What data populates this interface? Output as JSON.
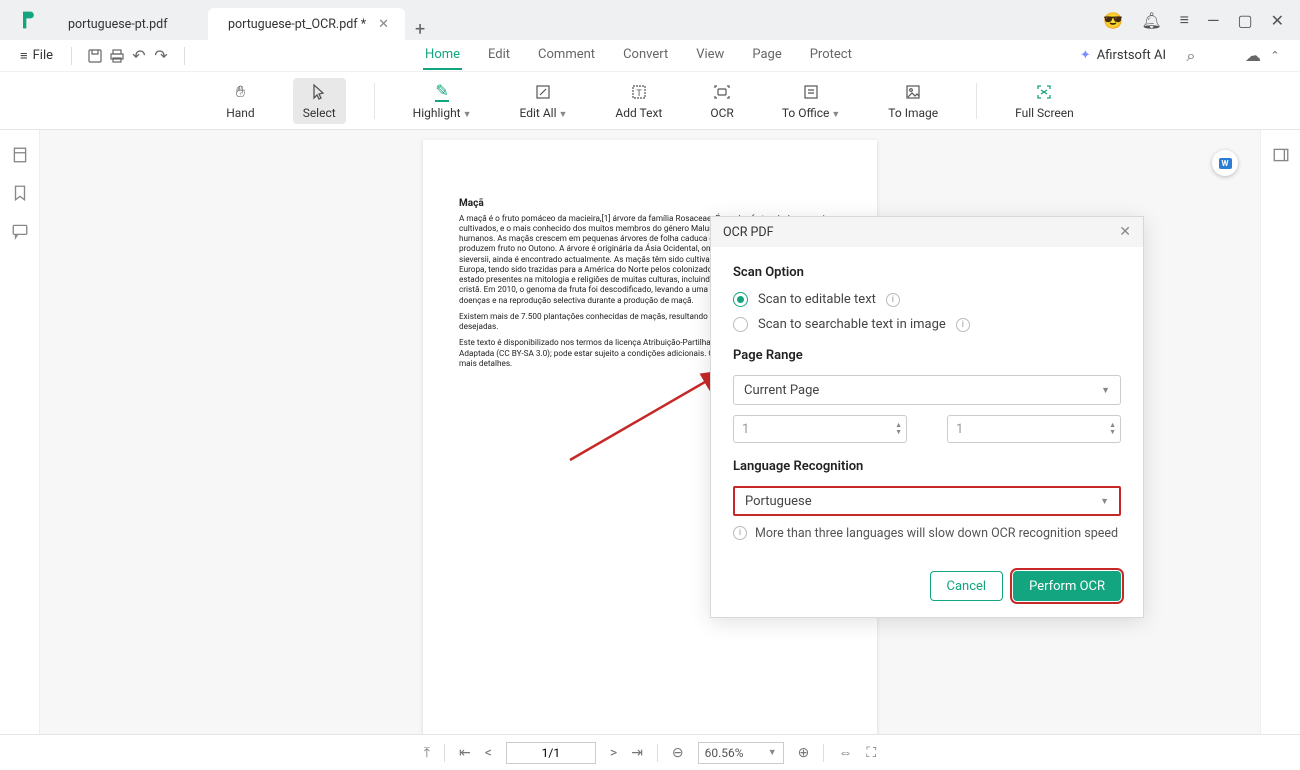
{
  "titlebar": {
    "tabs": [
      {
        "label": "portuguese-pt.pdf",
        "active": false
      },
      {
        "label": "portuguese-pt_OCR.pdf *",
        "active": true
      }
    ]
  },
  "menubar": {
    "file": "File",
    "tabs": [
      "Home",
      "Edit",
      "Comment",
      "Convert",
      "View",
      "Page",
      "Protect"
    ],
    "active_tab": "Home",
    "ai": "Afirstsoft AI"
  },
  "toolbar": {
    "hand": "Hand",
    "select": "Select",
    "highlight": "Highlight",
    "edit_all": "Edit All",
    "add_text": "Add Text",
    "ocr": "OCR",
    "to_office": "To Office",
    "to_image": "To Image",
    "full_screen": "Full Screen"
  },
  "document": {
    "title": "Maçã",
    "p1": "A maçã é o fruto pomáceo da macieira,[1] árvore da família Rosaceae. É um dos frutos de árvore mais cultivados, e o mais conhecido dos muitos membros do género Malus que são usados pelos seres humanos. As maçãs crescem em pequenas árvores de folha caduca que florescem na Primavera e produzem fruto no Outono. A árvore é originária da Ásia Ocidental, onde o seu ancestral selvagem, Malus sieversii, ainda é encontrado actualmente. As maçãs têm sido cultivadas há milhares de anos na Ásia e Europa, tendo sido trazidas para a América do Norte pelos colonizadores europeus. As maçãs têm estado presentes na mitologia e religiões de muitas culturas, incluindo as tradições nórdica, grega e cristã. Em 2010, o genoma da fruta foi descodificado, levando a uma nova compreensão no controlo de doenças e na reprodução selectiva durante a produção de maçã.",
    "p2": "Existem mais de 7.500 plantações conhecidas de maçãs, resultando numa gama de características desejadas.",
    "p3": "Este texto é disponibilizado nos termos da licença Atribuição-Partilha nos Mesmos Termos 3.0 não Adaptada (CC BY-SA 3.0); pode estar sujeito a condições adicionais. Consulte as condições de uso para mais detalhes."
  },
  "dialog": {
    "title": "OCR PDF",
    "scan_option_title": "Scan Option",
    "scan_editable": "Scan to editable text",
    "scan_searchable": "Scan to searchable text in image",
    "page_range_title": "Page Range",
    "page_range_value": "Current Page",
    "spinner_from": "1",
    "spinner_to": "1",
    "lang_title": "Language Recognition",
    "lang_value": "Portuguese",
    "lang_info": "More than three languages will slow down OCR recognition speed",
    "cancel": "Cancel",
    "perform": "Perform OCR"
  },
  "statusbar": {
    "page": "1/1",
    "zoom": "60.56%"
  }
}
